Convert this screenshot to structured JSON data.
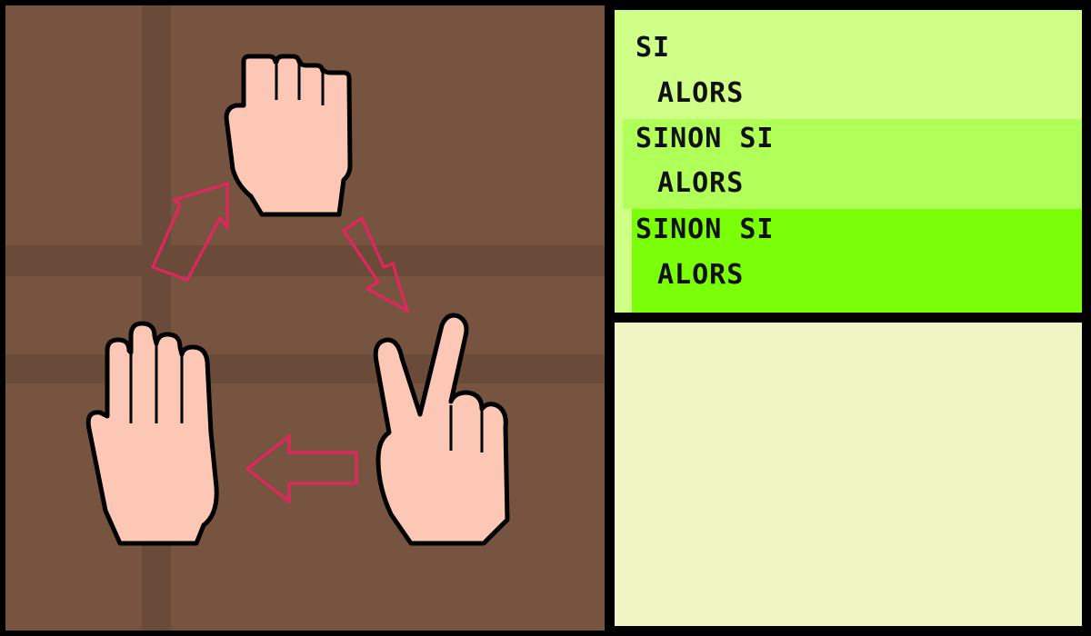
{
  "game": {
    "board": {
      "background_color": "#77543f",
      "grid_line_color": "#6a4a38",
      "hands": [
        {
          "gesture": "rock",
          "icon": "fist-icon"
        },
        {
          "gesture": "scissors",
          "icon": "peace-sign-hand-icon"
        },
        {
          "gesture": "paper",
          "icon": "open-hand-icon"
        }
      ],
      "cycle_arrows": [
        {
          "from": "rock",
          "to": "scissors"
        },
        {
          "from": "scissors",
          "to": "paper"
        },
        {
          "from": "paper",
          "to": "rock"
        }
      ],
      "arrow_color": "#e8235e",
      "skin_color": "#fcc7b4"
    },
    "code": {
      "lines": [
        {
          "keyword": "SI"
        },
        {
          "keyword": "ALORS"
        },
        {
          "keyword": "SINON SI"
        },
        {
          "keyword": "ALORS"
        },
        {
          "keyword": "SINON SI"
        },
        {
          "keyword": "ALORS"
        }
      ],
      "block_colors": [
        "#cfff87",
        "#b1ff59",
        "#7aff08"
      ]
    },
    "output_panel_color": "#eff5c3"
  }
}
